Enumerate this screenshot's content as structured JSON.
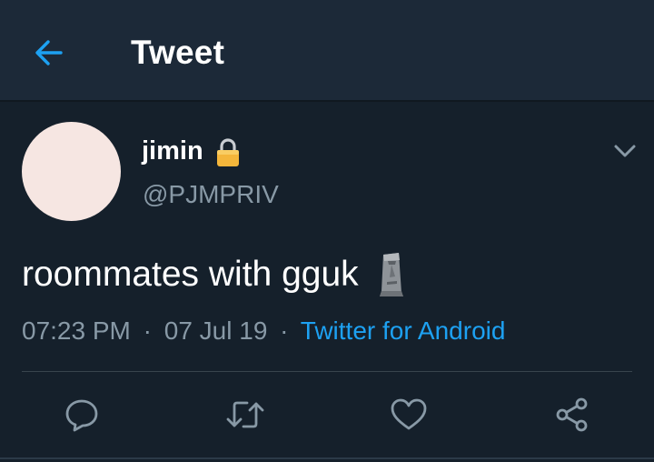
{
  "header": {
    "back_icon": "arrow-left-icon",
    "title": "Tweet"
  },
  "tweet": {
    "author": {
      "display_name": "jimin",
      "handle": "@PJMPRIV",
      "protected_icon": "lock-icon",
      "avatar_color": "#f6e6e2"
    },
    "more_icon": "chevron-down-icon",
    "text": "roommates with gguk",
    "emoji_icon": "moai-icon",
    "time": "07:23 PM",
    "separator": "·",
    "date": "07 Jul 19",
    "source": "Twitter for Android"
  },
  "actions": {
    "reply_icon": "reply-icon",
    "retweet_icon": "retweet-icon",
    "like_icon": "heart-icon",
    "share_icon": "share-icon"
  },
  "colors": {
    "background": "#15202b",
    "header_background": "#1c2938",
    "accent": "#1da1f2",
    "secondary_text": "#8899a6",
    "divider": "#38444d"
  }
}
